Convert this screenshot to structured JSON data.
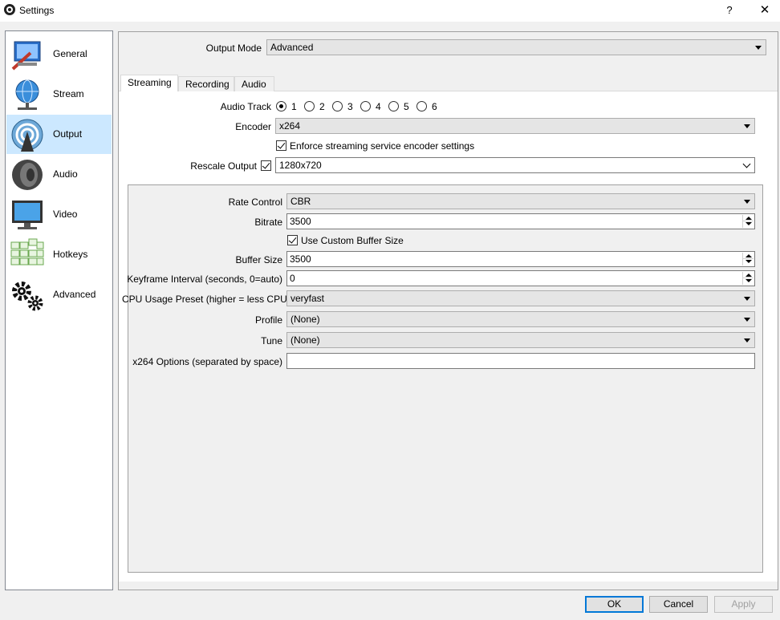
{
  "window": {
    "title": "Settings",
    "help": "?",
    "close": "✕"
  },
  "sidebar": {
    "items": [
      {
        "label": "General",
        "icon": "general-icon"
      },
      {
        "label": "Stream",
        "icon": "stream-icon"
      },
      {
        "label": "Output",
        "icon": "output-icon",
        "selected": true
      },
      {
        "label": "Audio",
        "icon": "audio-icon"
      },
      {
        "label": "Video",
        "icon": "video-icon"
      },
      {
        "label": "Hotkeys",
        "icon": "hotkeys-icon"
      },
      {
        "label": "Advanced",
        "icon": "advanced-icon"
      }
    ]
  },
  "output_mode": {
    "label": "Output Mode",
    "value": "Advanced"
  },
  "tabs": [
    {
      "label": "Streaming",
      "active": true
    },
    {
      "label": "Recording"
    },
    {
      "label": "Audio"
    }
  ],
  "streaming": {
    "audio_track": {
      "label": "Audio Track",
      "options": [
        "1",
        "2",
        "3",
        "4",
        "5",
        "6"
      ],
      "selected": "1"
    },
    "encoder": {
      "label": "Encoder",
      "value": "x264"
    },
    "enforce": {
      "label": "Enforce streaming service encoder settings",
      "checked": true
    },
    "rescale": {
      "label": "Rescale Output",
      "checked": true,
      "value": "1280x720"
    }
  },
  "encoder_settings": {
    "rate_control": {
      "label": "Rate Control",
      "value": "CBR"
    },
    "bitrate": {
      "label": "Bitrate",
      "value": "3500"
    },
    "custom_buffer": {
      "label": "Use Custom Buffer Size",
      "checked": true
    },
    "buffer_size": {
      "label": "Buffer Size",
      "value": "3500"
    },
    "keyframe": {
      "label": "Keyframe Interval (seconds, 0=auto)",
      "value": "0"
    },
    "cpu_preset": {
      "label": "CPU Usage Preset (higher = less CPU)",
      "value": "veryfast"
    },
    "profile": {
      "label": "Profile",
      "value": "(None)"
    },
    "tune": {
      "label": "Tune",
      "value": "(None)"
    },
    "x264_options": {
      "label": "x264 Options (separated by space)",
      "value": ""
    }
  },
  "buttons": {
    "ok": "OK",
    "cancel": "Cancel",
    "apply": "Apply"
  },
  "colors": {
    "selection": "#cce8ff",
    "accent": "#0078d7",
    "panel": "#f0f0f0"
  }
}
